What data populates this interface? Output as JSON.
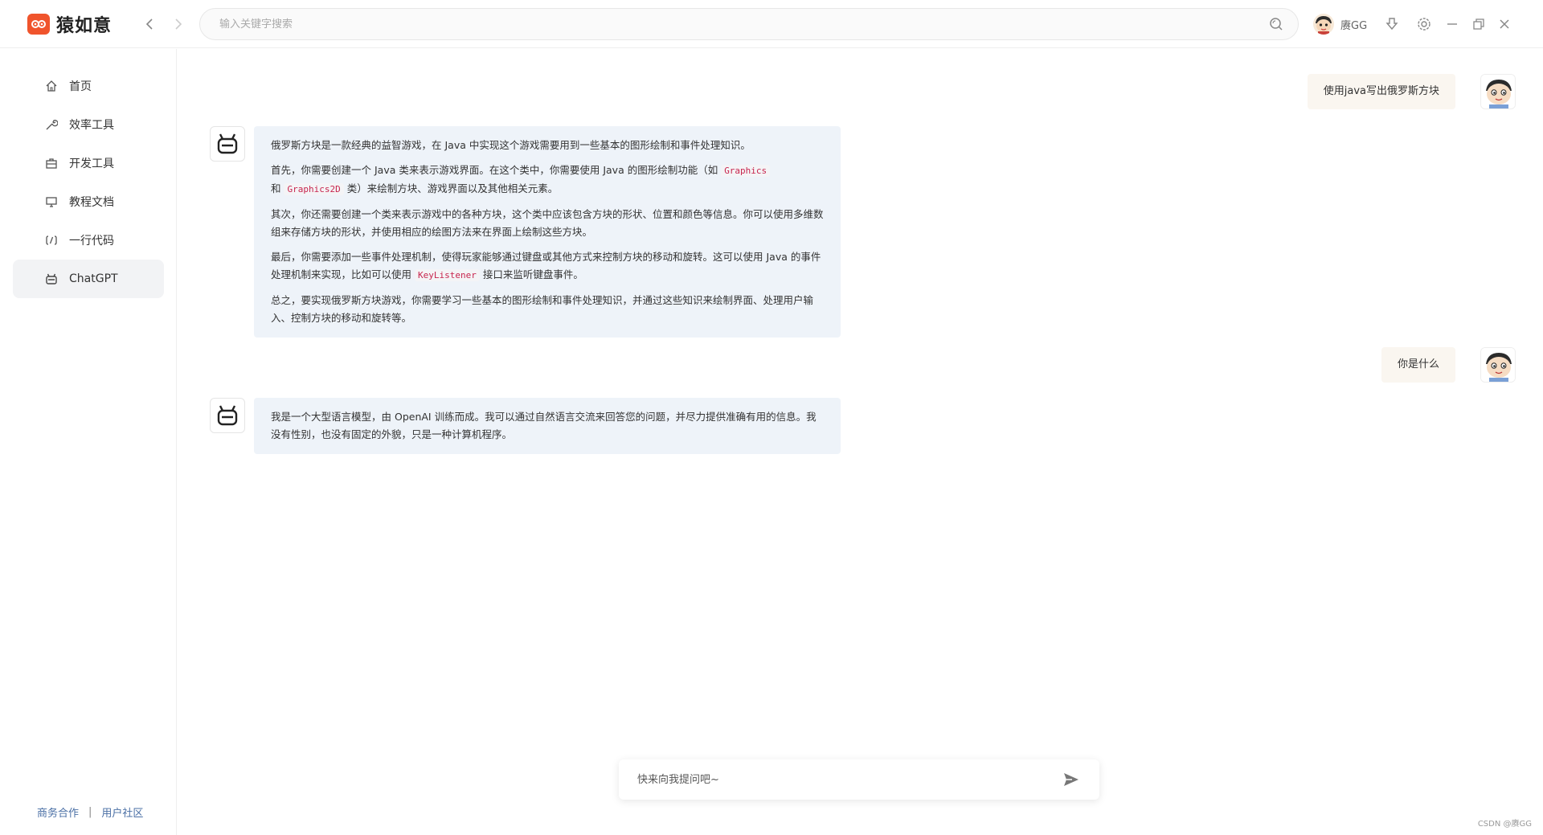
{
  "app": {
    "title": "猿如意",
    "brand_color": "#f0542c"
  },
  "search": {
    "placeholder": "输入关键字搜索",
    "icon": "search-icon"
  },
  "user": {
    "name": "赓GG"
  },
  "sidebar": {
    "items": [
      {
        "label": "首页",
        "icon": "home-icon"
      },
      {
        "label": "效率工具",
        "icon": "wrench-icon"
      },
      {
        "label": "开发工具",
        "icon": "toolbox-icon"
      },
      {
        "label": "教程文档",
        "icon": "monitor-icon"
      },
      {
        "label": "一行代码",
        "icon": "code-icon"
      },
      {
        "label": "ChatGPT",
        "icon": "robot-icon",
        "active": true
      }
    ],
    "footer": {
      "business": "商务合作",
      "separator": "|",
      "community": "用户社区"
    }
  },
  "chat": {
    "q1": "使用java写出俄罗斯方块",
    "a1": {
      "p1": "俄罗斯方块是一款经典的益智游戏，在 Java 中实现这个游戏需要用到一些基本的图形绘制和事件处理知识。",
      "p2_a": "首先，你需要创建一个 Java 类来表示游戏界面。在这个类中，你需要使用 Java 的图形绘制功能（如 ",
      "p2_code1": "Graphics",
      "p2_b": "和 ",
      "p2_code2": "Graphics2D",
      "p2_c": " 类）来绘制方块、游戏界面以及其他相关元素。",
      "p3": "其次，你还需要创建一个类来表示游戏中的各种方块，这个类中应该包含方块的形状、位置和颜色等信息。你可以使用多维数组来存储方块的形状，并使用相应的绘图方法来在界面上绘制这些方块。",
      "p4_a": "最后，你需要添加一些事件处理机制，使得玩家能够通过键盘或其他方式来控制方块的移动和旋转。这可以使用 Java 的事件处理机制来实现，比如可以使用 ",
      "p4_code": "KeyListener",
      "p4_b": " 接口来监听键盘事件。",
      "p5": "总之，要实现俄罗斯方块游戏，你需要学习一些基本的图形绘制和事件处理知识，并通过这些知识来绘制界面、处理用户输入、控制方块的移动和旋转等。"
    },
    "q2": "你是什么",
    "a2": "我是一个大型语言模型，由 OpenAI 训练而成。我可以通过自然语言交流来回答您的问题，并尽力提供准确有用的信息。我没有性别，也没有固定的外貌，只是一种计算机程序。"
  },
  "composer": {
    "placeholder": "快来向我提问吧~",
    "send_icon": "send-icon"
  },
  "watermark": "CSDN @赓GG"
}
